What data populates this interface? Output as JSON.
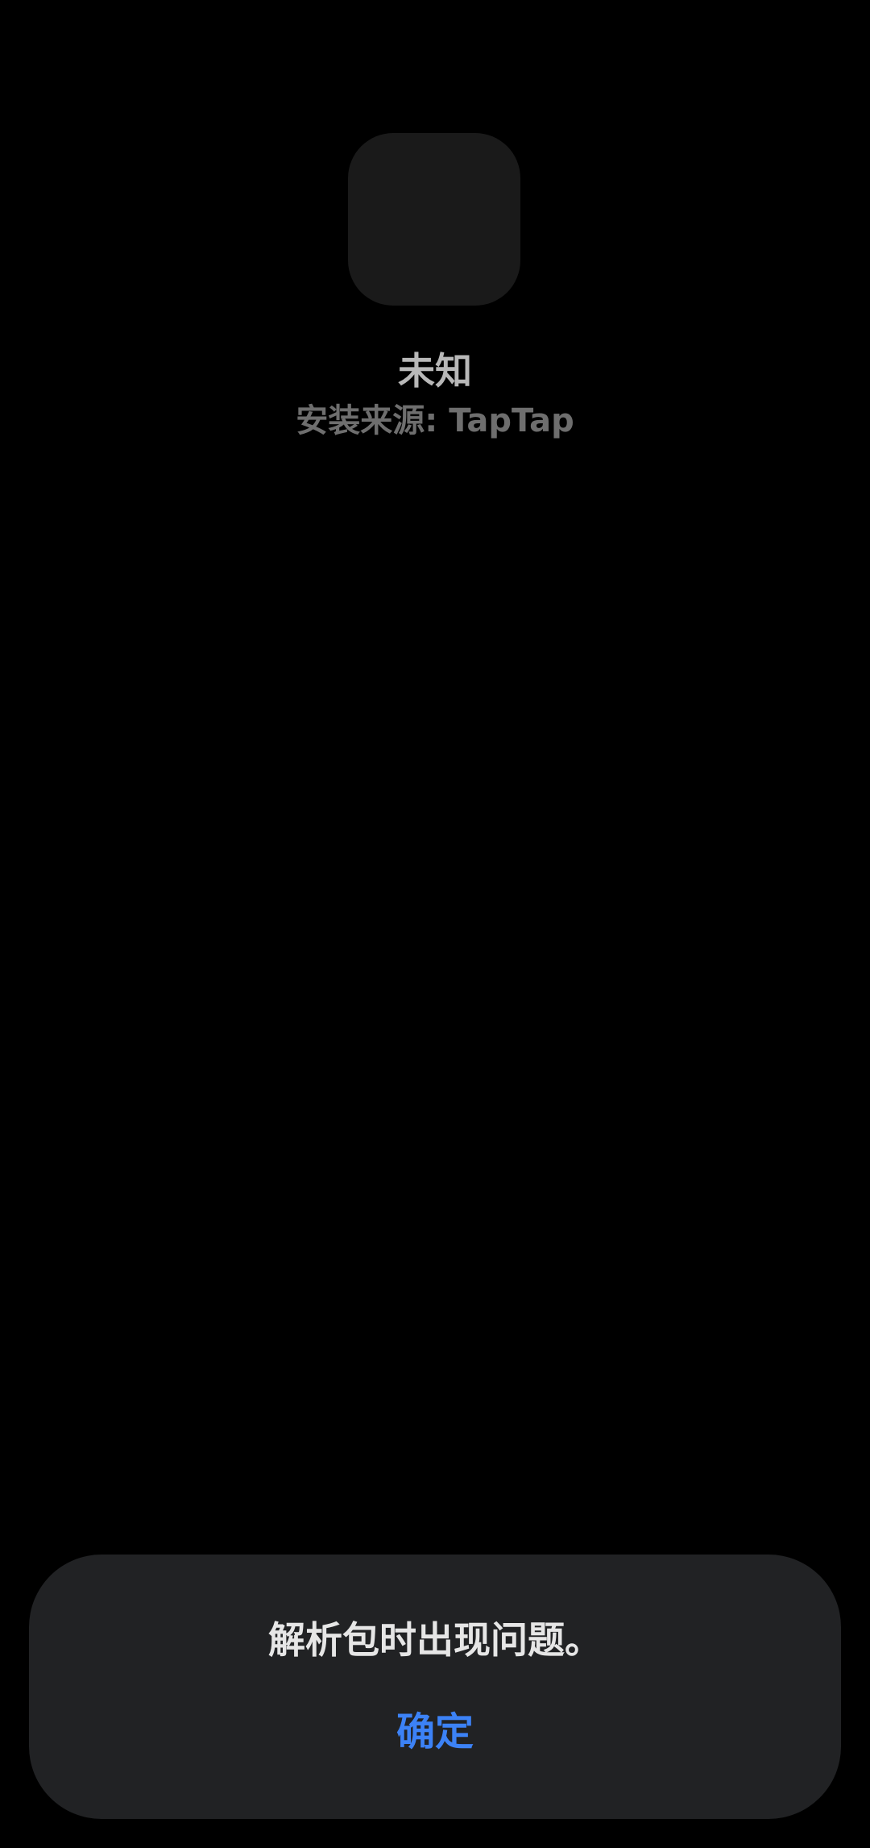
{
  "app": {
    "name": "未知",
    "install_source": "安装来源: TapTap"
  },
  "dialog": {
    "message": "解析包时出现问题。",
    "confirm_label": "确定"
  },
  "colors": {
    "background": "#000000",
    "icon_placeholder": "#1a1a1a",
    "dialog_background": "#212224",
    "accent": "#3c82f6"
  }
}
